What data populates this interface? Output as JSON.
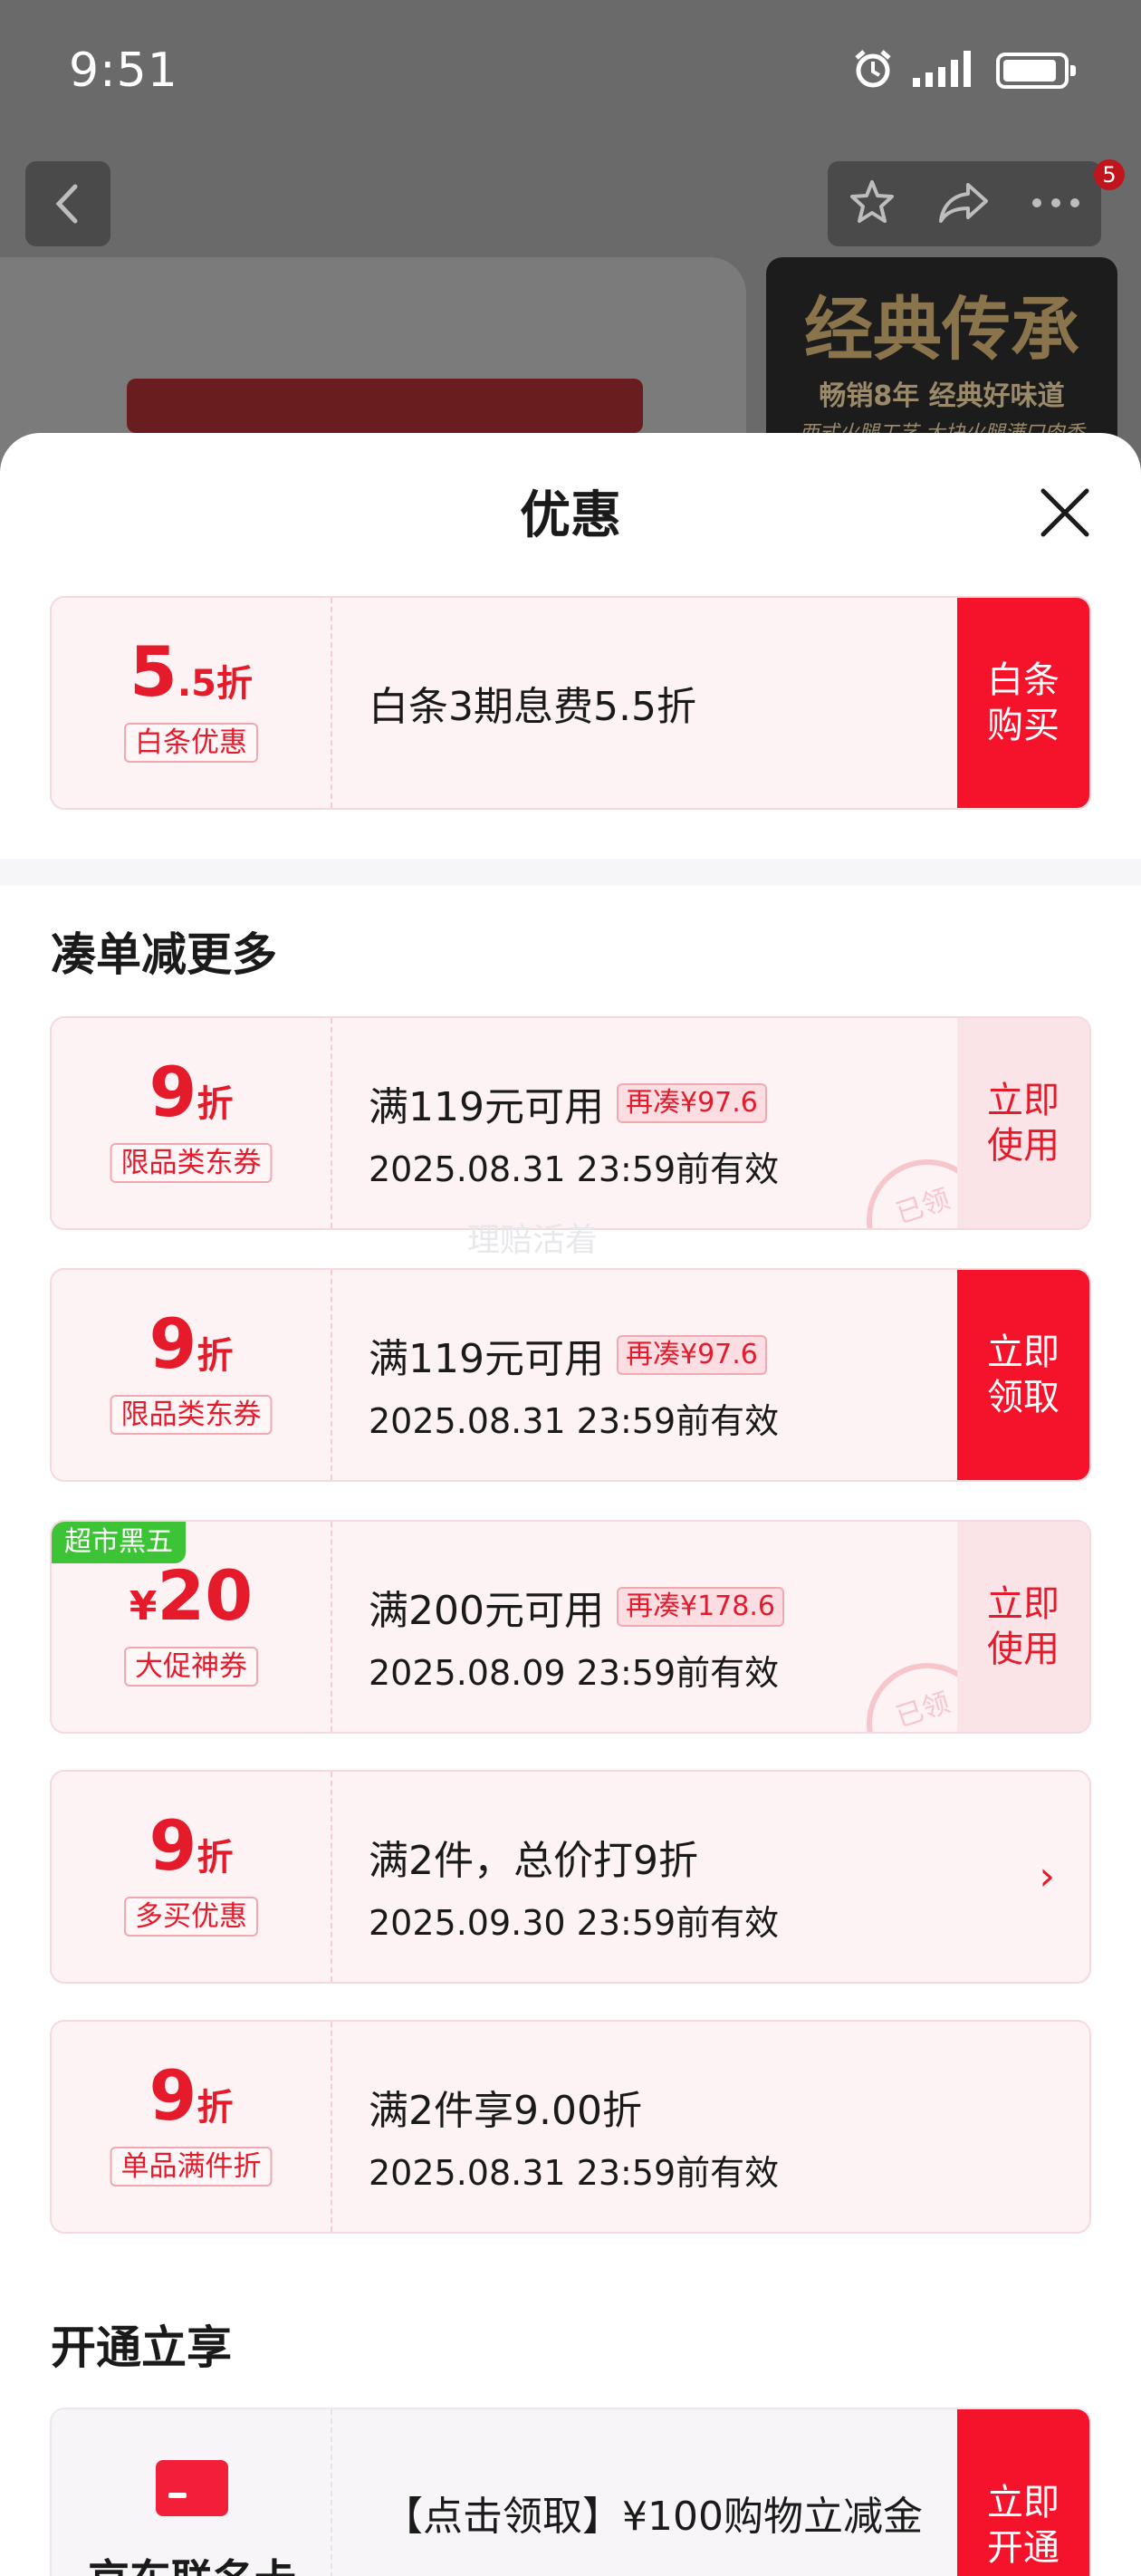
{
  "status_bar": {
    "time": "9:51"
  },
  "background": {
    "badge_count": "5",
    "banner": {
      "title": "经典传承",
      "line1": "畅销8年 经典好味道",
      "line2": "西式火腿工艺 大块火腿满口肉香"
    }
  },
  "sheet": {
    "title": "优惠",
    "baitiao": {
      "amount_big": "5",
      "amount_small": ".5折",
      "tag": "白条优惠",
      "desc": "白条3期息费5.5折",
      "button": "白条\n购买"
    },
    "section_more": "凑单减更多",
    "coupons": [
      {
        "amount_big": "9",
        "amount_small": "折",
        "tag": "限品类东券",
        "line1": "满119元可用",
        "extra": "再凑¥97.6",
        "line2": "2025.08.31 23:59前有效",
        "button": "立即\n使用",
        "stamp": "已领"
      },
      {
        "amount_big": "9",
        "amount_small": "折",
        "tag": "限品类东券",
        "line1": "满119元可用",
        "extra": "再凑¥97.6",
        "line2": "2025.08.31 23:59前有效",
        "button": "立即\n领取"
      },
      {
        "ribbon": "超市黑五",
        "yen": "¥",
        "amount_big": "20",
        "tag": "大促神券",
        "line1": "满200元可用",
        "extra": "再凑¥178.6",
        "line2": "2025.08.09 23:59前有效",
        "button": "立即\n使用",
        "stamp": "已领"
      },
      {
        "amount_big": "9",
        "amount_small": "折",
        "tag": "多买优惠",
        "line1": "满2件，总价打9折",
        "line2": "2025.09.30 23:59前有效",
        "chevron": "›"
      },
      {
        "amount_big": "9",
        "amount_small": "折",
        "tag": "单品满件折",
        "line1": "满2件享9.00折",
        "line2": "2025.08.31 23:59前有效"
      }
    ],
    "watermark": "理赔活着",
    "section_open": "开通立享",
    "union": {
      "name": "京东联名卡",
      "desc": "【点击领取】¥100购物立减金",
      "button": "立即\n开通"
    }
  },
  "colors": {
    "accent": "#f5132c",
    "price_red": "#e51b2b",
    "ribbon_green": "#3cc436"
  },
  "icons": [
    "back-icon",
    "star-icon",
    "share-icon",
    "more-icon",
    "close-icon",
    "alarm-icon",
    "signal-icon",
    "battery-icon",
    "card-icon"
  ]
}
